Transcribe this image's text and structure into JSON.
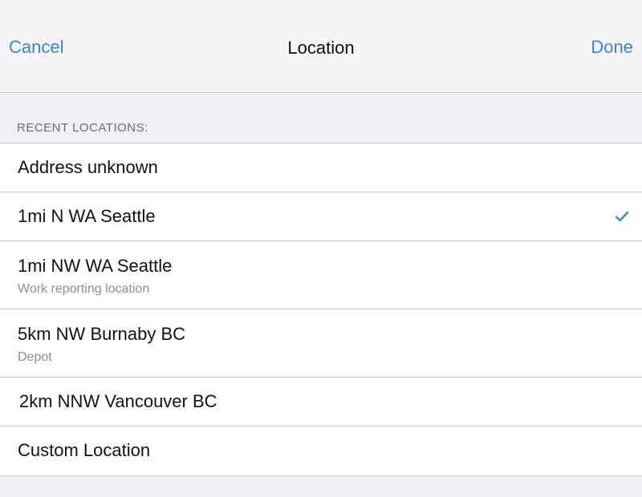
{
  "nav": {
    "cancel_label": "Cancel",
    "title": "Location",
    "done_label": "Done"
  },
  "section": {
    "header": "RECENT LOCATIONS:"
  },
  "locations": [
    {
      "title": "Address unknown",
      "subtitle": "",
      "selected": false
    },
    {
      "title": "1mi N WA Seattle",
      "subtitle": "",
      "selected": true
    },
    {
      "title": "1mi NW WA Seattle",
      "subtitle": "Work reporting location",
      "selected": false
    },
    {
      "title": "5km NW Burnaby BC",
      "subtitle": "Depot",
      "selected": false
    },
    {
      "title": "2km NNW Vancouver BC",
      "subtitle": "",
      "selected": false
    },
    {
      "title": "Custom Location",
      "subtitle": "",
      "selected": false
    }
  ],
  "colors": {
    "accent": "#3b82e0",
    "background": "#efeff4",
    "separator": "#c8c8cc"
  },
  "icons": {
    "selected": "checkmark-icon"
  }
}
